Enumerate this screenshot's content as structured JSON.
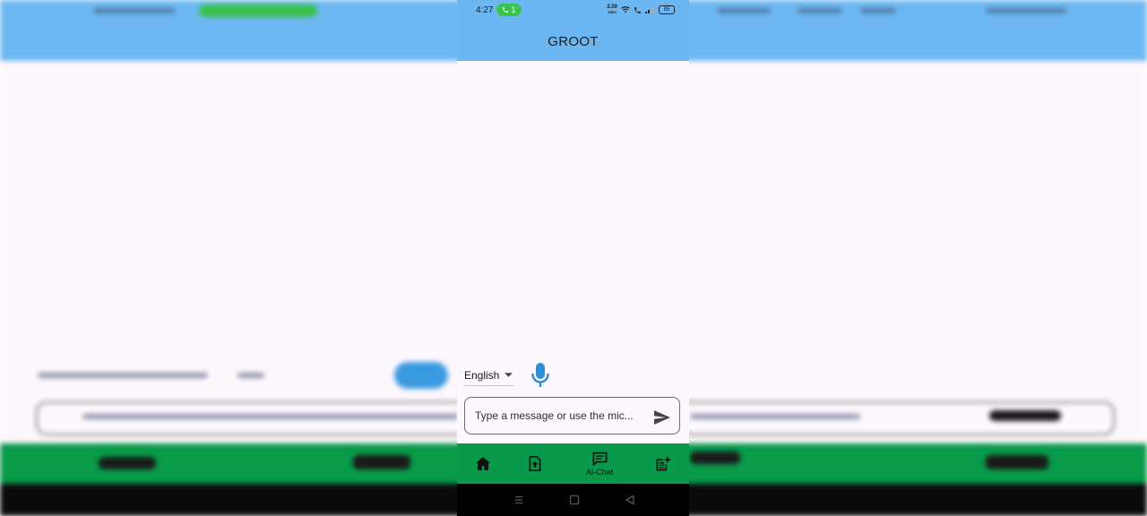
{
  "status_bar": {
    "time": "4:27",
    "call_badge": "1",
    "net_speed_value": "2.00",
    "net_speed_unit": "KB/S",
    "battery": "85"
  },
  "app_bar": {
    "title": "GROOT"
  },
  "chat": {
    "language_selected": "English",
    "message_placeholder": "Type a message or use the mic..."
  },
  "bottom_nav": {
    "items": [
      {
        "icon": "home-icon",
        "label": ""
      },
      {
        "icon": "upload-file-icon",
        "label": ""
      },
      {
        "icon": "chat-icon",
        "label": "AI-Chat"
      },
      {
        "icon": "post-add-icon",
        "label": ""
      }
    ]
  },
  "colors": {
    "app_bar": "#6cb7f1",
    "bottom_nav": "#08994a",
    "background": "#fdf7fe",
    "mic_accent": "#2c8fd6"
  }
}
